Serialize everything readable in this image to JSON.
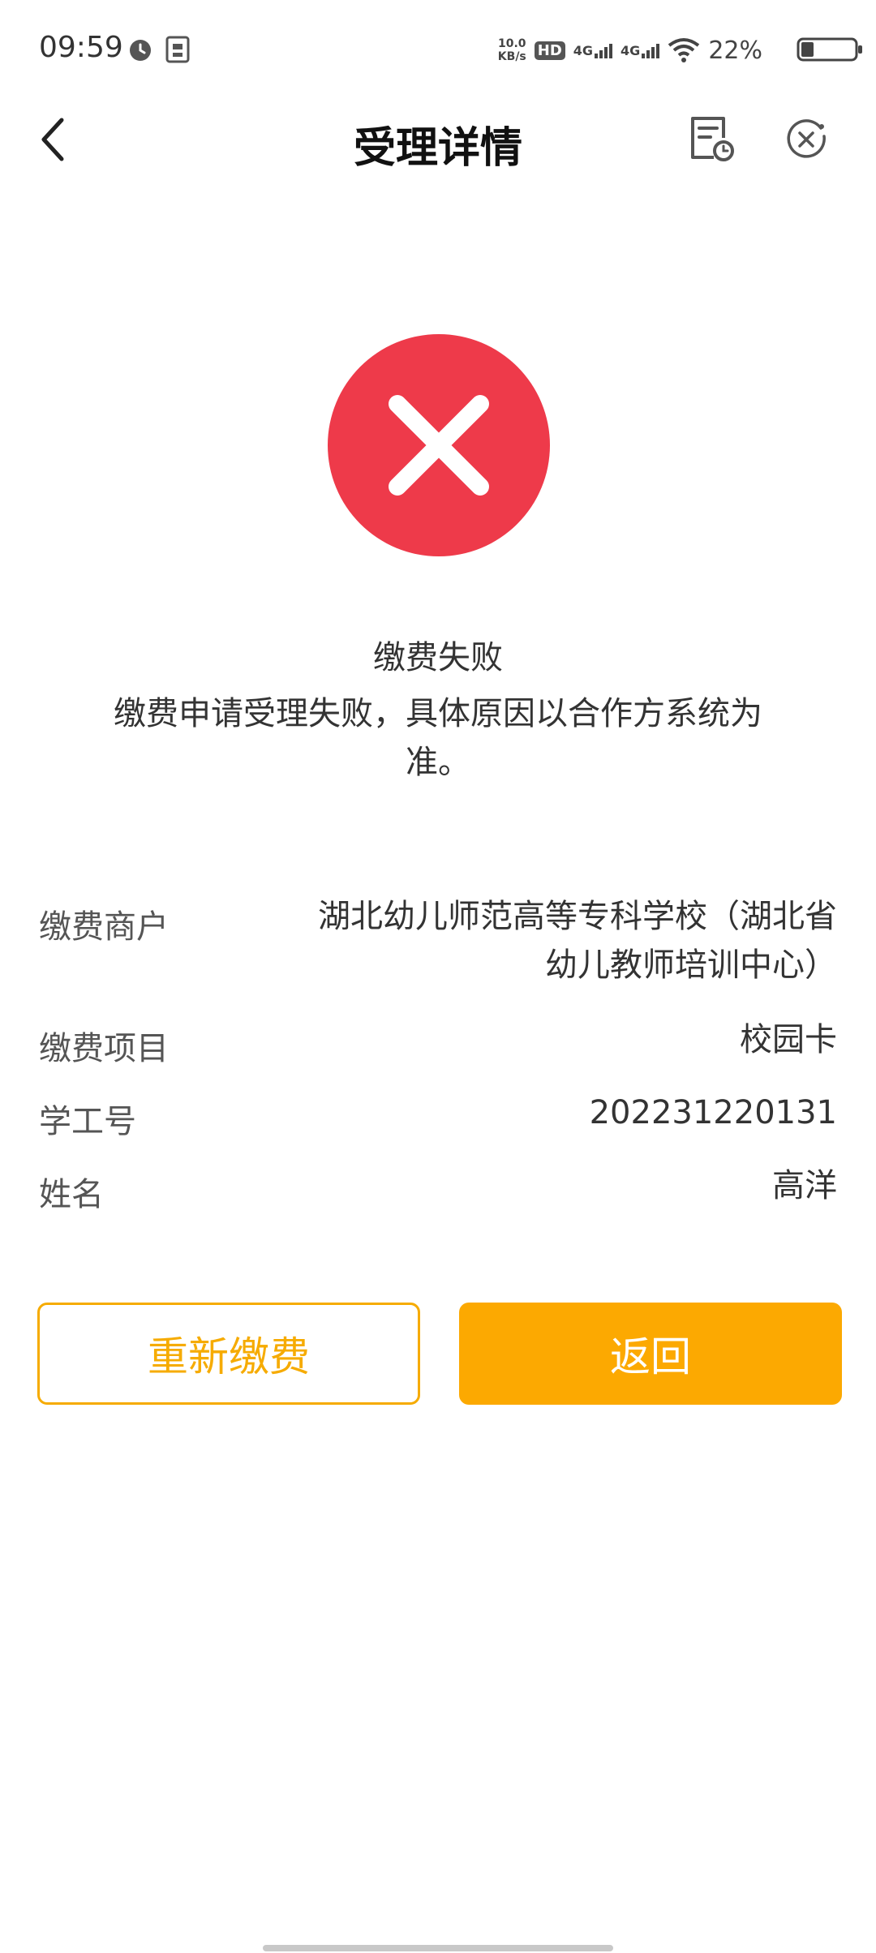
{
  "status_bar": {
    "time": "09:59",
    "net_speed_value": "10.0",
    "net_speed_unit": "KB/s",
    "hd": "HD",
    "hd_sup": "1",
    "hd_sub": "2",
    "sim1_net": "4G",
    "sim2_net": "4G",
    "battery_percent": "22%",
    "battery_level": 0.22
  },
  "nav": {
    "title": "受理详情"
  },
  "result": {
    "status": "缴费失败",
    "description": "缴费申请受理失败，具体原因以合作方系统为准。",
    "icon_color": "#EE3A4A"
  },
  "details": {
    "merchant_label": "缴费商户",
    "merchant_value": "湖北幼儿师范高等专科学校（湖北省幼儿教师培训中心）",
    "item_label": "缴费项目",
    "item_value": "校园卡",
    "id_label": "学工号",
    "id_value": "202231220131",
    "name_label": "姓名",
    "name_value": "高洋"
  },
  "buttons": {
    "retry": "重新缴费",
    "back": "返回"
  },
  "colors": {
    "accent": "#FCA901",
    "error": "#EE3A4A"
  }
}
